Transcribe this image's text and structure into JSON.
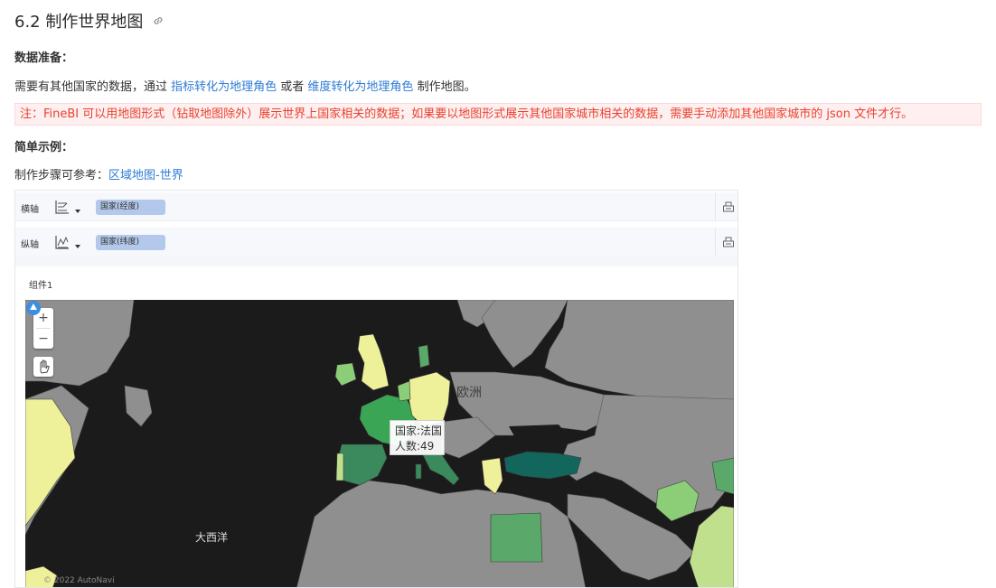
{
  "section": {
    "title": "6.2 制作世界地图"
  },
  "content": {
    "data_prep_heading": "数据准备：",
    "data_prep_text_pre": "需要有其他国家的数据，通过 ",
    "link_indicator": "指标转化为地理角色",
    "data_prep_text_mid": " 或者 ",
    "link_dimension": "维度转化为地理角色",
    "data_prep_text_post": " 制作地图。",
    "note": "注：FineBI 可以用地图形式（钻取地图除外）展示世界上国家相关的数据；如果要以地图形式展示其他国家城市相关的数据，需要手动添加其他国家城市的 json 文件才行。",
    "example_heading": "简单示例：",
    "steps_text": "制作步骤可参考：",
    "link_steps": "区域地图-世界"
  },
  "panel": {
    "x_axis": {
      "label": "横轴",
      "field": "国家(经度)"
    },
    "y_axis": {
      "label": "纵轴",
      "field": "国家(纬度)"
    },
    "component_title": "组件1"
  },
  "map": {
    "zoom_in": "+",
    "zoom_out": "−",
    "tooltip_line1": "国家:法国",
    "tooltip_line2": "人数:49",
    "region_label": "欧洲",
    "ocean_label": "大西洋",
    "attribution": "© 2022 AutoNavi",
    "colors": {
      "land": "#8f8f8f",
      "ocean": "#1b1b1b",
      "light_yellow": "#eff09a",
      "light_green": "#c0e08d",
      "mid_green": "#8ccd78",
      "green": "#5ba96a",
      "dark_green": "#3b8a5d",
      "teal": "#12665b"
    }
  }
}
